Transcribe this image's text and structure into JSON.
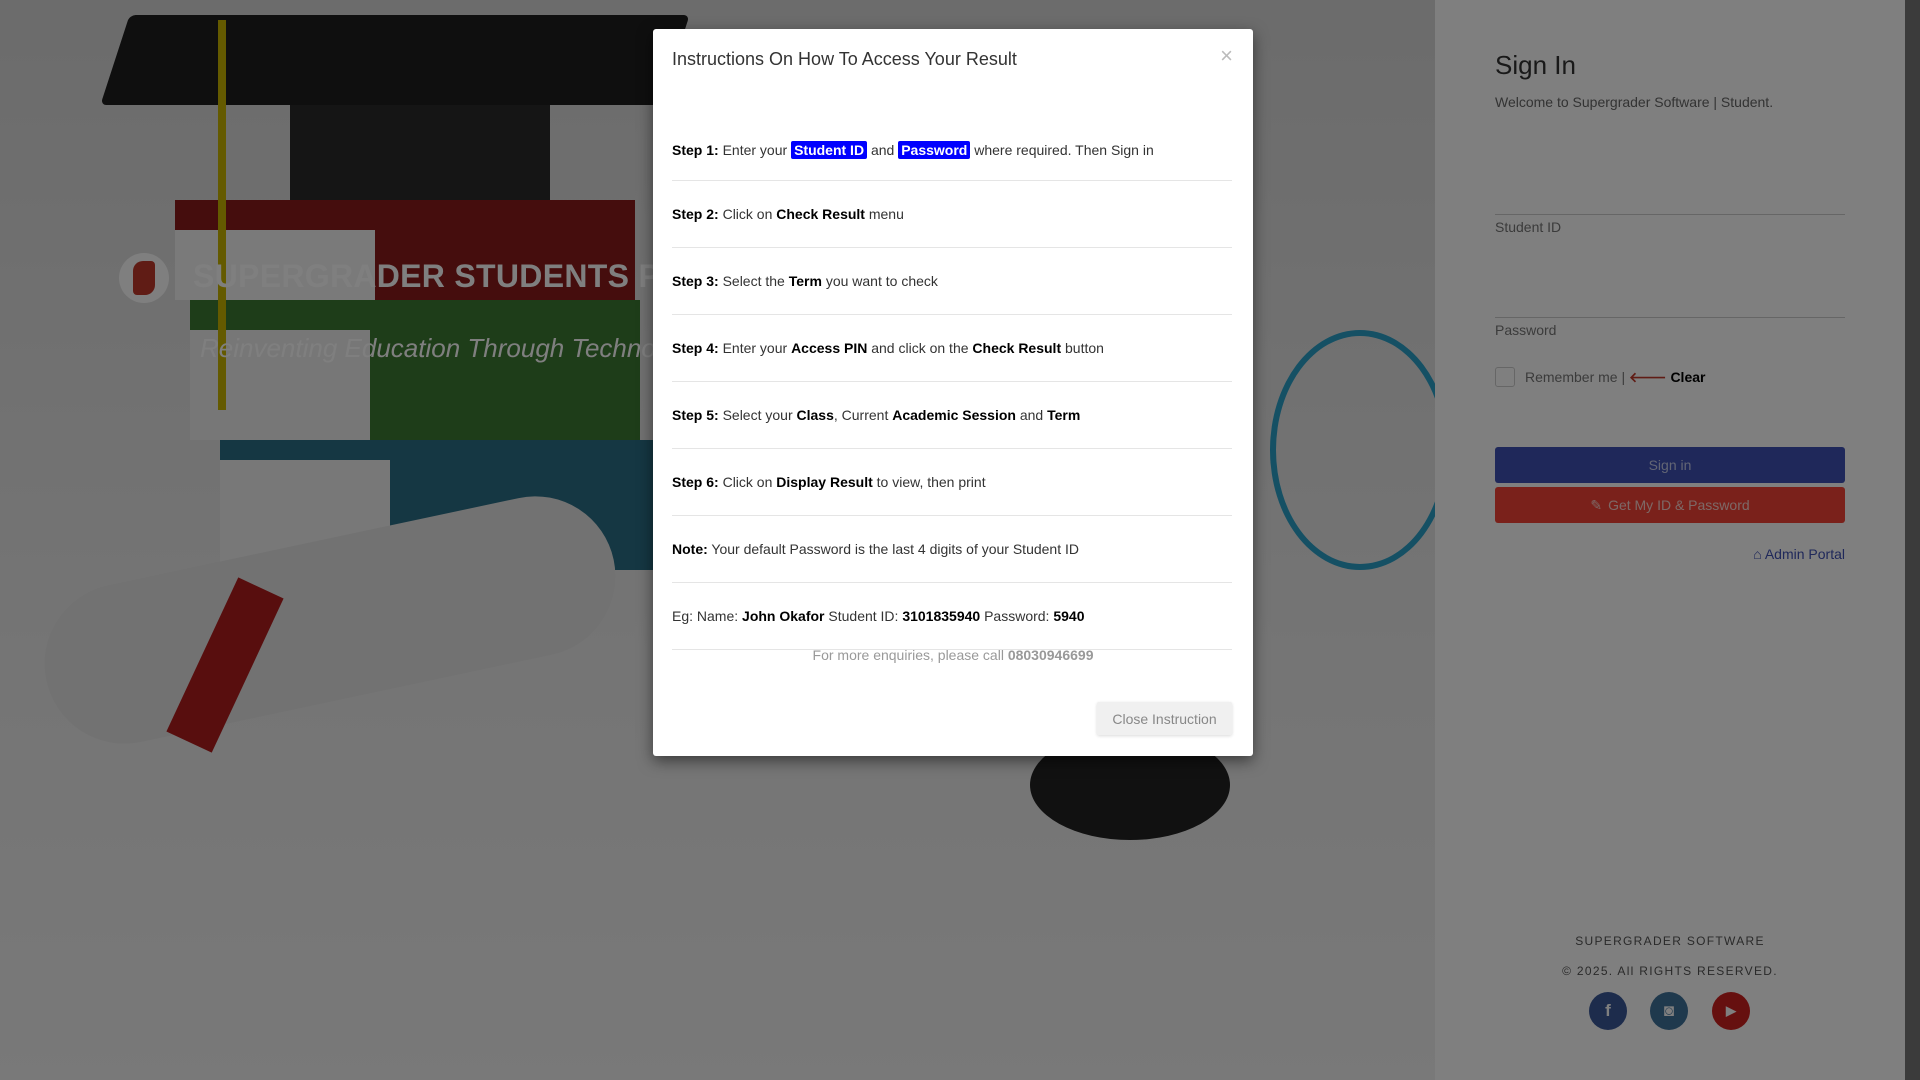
{
  "hero": {
    "brand": "SUPERGRADER STUDENTS PORTAL",
    "tagline": "Reinventing Education Through Technology"
  },
  "signin": {
    "title": "Sign In",
    "welcome": "Welcome to Supergrader Software | Student.",
    "student_id_label": "Student ID",
    "password_label": "Password",
    "remember": "Remember me |",
    "clear": "Clear",
    "signin_button": "Sign in",
    "get_id_button": "Get My ID & Password",
    "admin_link": "Admin Portal",
    "footer_company": "SUPERGRADER SOFTWARE",
    "footer_copyright": "© 2025. All RIGHTS RESERVED.",
    "social": [
      {
        "name": "facebook",
        "glyph": "f",
        "color": "#3b5998"
      },
      {
        "name": "instagram",
        "glyph": "◙",
        "color": "#3f729b"
      },
      {
        "name": "youtube",
        "glyph": "▶",
        "color": "#cd201f"
      }
    ]
  },
  "modal": {
    "title": "Instructions On How To Access Your Result",
    "close_symbol": "×",
    "rows": [
      [
        {
          "t": "Step 1:",
          "b": 1
        },
        {
          "t": " Enter your "
        },
        {
          "t": "Student ID",
          "h": 1
        },
        {
          "t": " and "
        },
        {
          "t": "Password",
          "h": 1
        },
        {
          "t": " where required. Then Sign in"
        }
      ],
      [
        {
          "t": "Step 2:",
          "b": 1
        },
        {
          "t": " Click on "
        },
        {
          "t": "Check Result",
          "b": 1
        },
        {
          "t": " menu"
        }
      ],
      [
        {
          "t": "Step 3:",
          "b": 1
        },
        {
          "t": " Select the "
        },
        {
          "t": "Term",
          "b": 1
        },
        {
          "t": " you want to check"
        }
      ],
      [
        {
          "t": "Step 4:",
          "b": 1
        },
        {
          "t": " Enter your "
        },
        {
          "t": "Access PIN",
          "b": 1
        },
        {
          "t": " and click on the "
        },
        {
          "t": "Check Result",
          "b": 1
        },
        {
          "t": " button"
        }
      ],
      [
        {
          "t": "Step 5:",
          "b": 1
        },
        {
          "t": " Select your "
        },
        {
          "t": "Class",
          "b": 1
        },
        {
          "t": ", Current "
        },
        {
          "t": "Academic Session",
          "b": 1
        },
        {
          "t": " and "
        },
        {
          "t": "Term",
          "b": 1
        }
      ],
      [
        {
          "t": "Step 6:",
          "b": 1
        },
        {
          "t": " Click on "
        },
        {
          "t": "Display Result",
          "b": 1
        },
        {
          "t": " to view, then print"
        }
      ],
      [
        {
          "t": "Note:",
          "b": 1
        },
        {
          "t": " Your default Password is the last 4 digits of your Student ID"
        }
      ],
      [
        {
          "t": "Eg: Name: "
        },
        {
          "t": "John Okafor",
          "b": 1
        },
        {
          "t": " Student ID: "
        },
        {
          "t": "3101835940",
          "b": 1
        },
        {
          "t": " Password: "
        },
        {
          "t": "5940",
          "b": 1
        }
      ]
    ],
    "enquiry_text": "For more enquiries, please call ",
    "enquiry_phone": "08030946699",
    "close_button": "Close Instruction"
  }
}
